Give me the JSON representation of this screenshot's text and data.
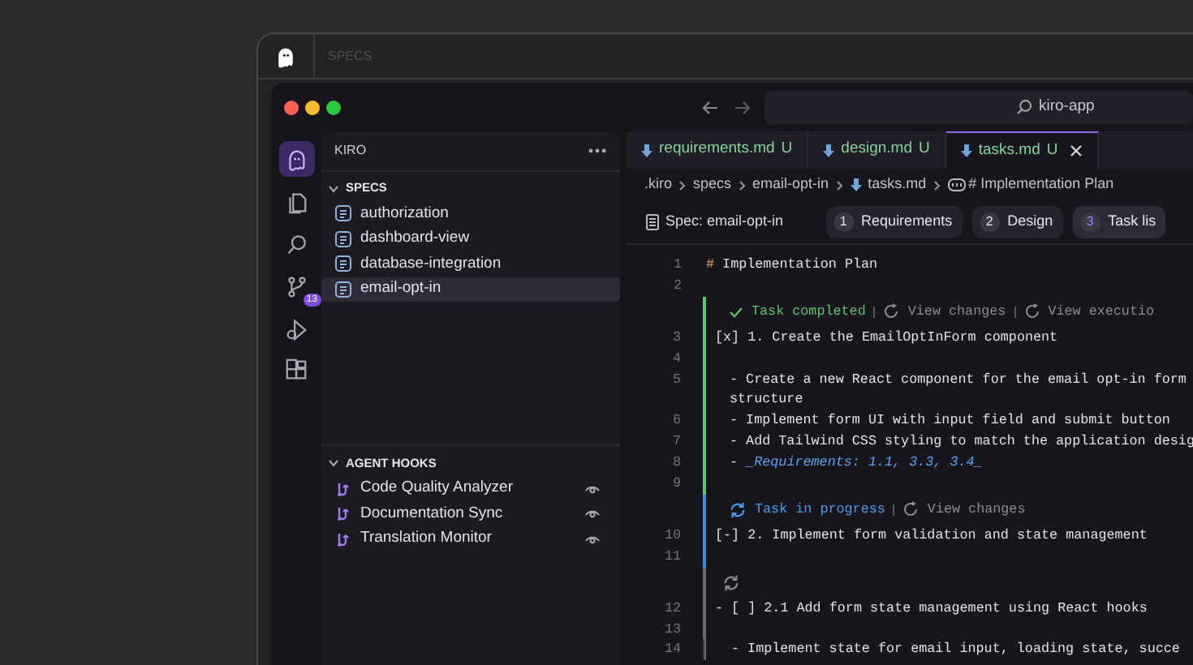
{
  "app_bar": {
    "title": "SPECS"
  },
  "window": {
    "search": "kiro-app"
  },
  "activity_bar": [
    {
      "selected": true
    },
    {
      "selected": false
    },
    {
      "selected": false
    },
    {
      "selected": false,
      "badge": "13"
    },
    {
      "selected": false
    },
    {
      "selected": false
    }
  ],
  "sidebar": {
    "title": "KIRO",
    "sections": [
      {
        "title": "SPECS",
        "kind": "spec",
        "expanded": true,
        "items": [
          {
            "label": "authorization",
            "selected": false
          },
          {
            "label": "dashboard-view",
            "selected": false
          },
          {
            "label": "database-integration",
            "selected": false
          },
          {
            "label": "email-opt-in",
            "selected": true
          }
        ]
      },
      {
        "title": "AGENT HOOKS",
        "kind": "hook",
        "expanded": true,
        "items": [
          {
            "label": "Code Quality Analyzer",
            "selected": false
          },
          {
            "label": "Documentation Sync",
            "selected": false
          },
          {
            "label": "Translation Monitor",
            "selected": false
          }
        ]
      }
    ]
  },
  "tabs": [
    {
      "label": "requirements.md",
      "status": "U",
      "selected": false
    },
    {
      "label": "design.md",
      "status": "U",
      "selected": false
    },
    {
      "label": "tasks.md",
      "status": "U",
      "selected": true
    }
  ],
  "breadcrumb": [
    {
      "label": ".kiro",
      "kind": "folder"
    },
    {
      "label": "specs",
      "kind": "folder"
    },
    {
      "label": "email-opt-in",
      "kind": "folder"
    },
    {
      "label": "tasks.md",
      "kind": "file"
    },
    {
      "label": "# Implementation Plan",
      "kind": "symbol"
    }
  ],
  "spec_bar": {
    "label": "Spec: email-opt-in",
    "steps": [
      {
        "number": "1",
        "label": "Requirements",
        "selected": false
      },
      {
        "number": "2",
        "label": "Design",
        "selected": false
      },
      {
        "number": "3",
        "label": "Task lis",
        "selected": true
      }
    ]
  },
  "editor": {
    "blocks": [
      {
        "kind": "plain",
        "lines": [
          {
            "number": "1",
            "kind": "heading",
            "marker": "#",
            "text": "Implementation Plan"
          },
          {
            "number": "2",
            "kind": "blank"
          }
        ]
      },
      {
        "kind": "completed",
        "status_label": "Task completed",
        "actions": [
          "View changes",
          "View executio"
        ],
        "lines": [
          {
            "number": "3",
            "kind": "task",
            "text": "[x] 1. Create the EmailOptInForm component"
          },
          {
            "number": "4",
            "kind": "blank"
          },
          {
            "number": "5",
            "kind": "detail",
            "text": "- Create a new React component for the email opt-in form"
          },
          {
            "kind": "detail",
            "text": "structure"
          },
          {
            "number": "6",
            "kind": "detail",
            "text": "- Implement form UI with input field and submit button"
          },
          {
            "number": "7",
            "kind": "detail",
            "text": "- Add Tailwind CSS styling to match the application desig"
          },
          {
            "number": "8",
            "kind": "requirements",
            "marker": "-",
            "text": "_Requirements: 1.1, 3.3, 3.4_"
          },
          {
            "number": "9",
            "kind": "blank"
          }
        ]
      },
      {
        "kind": "in_progress",
        "status_label": "Task in progress",
        "actions": [
          "View changes"
        ],
        "lines": [
          {
            "number": "10",
            "kind": "task",
            "text": "[-] 2. Implement form validation and state management"
          },
          {
            "number": "11",
            "kind": "blank"
          }
        ]
      },
      {
        "kind": "pending",
        "lines": [
          {
            "number": "12",
            "kind": "task",
            "text": "- [ ] 2.1 Add form state management using React hooks"
          },
          {
            "number": "13",
            "kind": "blank"
          },
          {
            "number": "14",
            "kind": "detail",
            "text": "- Implement state for email input, loading state, succe"
          }
        ]
      }
    ]
  }
}
